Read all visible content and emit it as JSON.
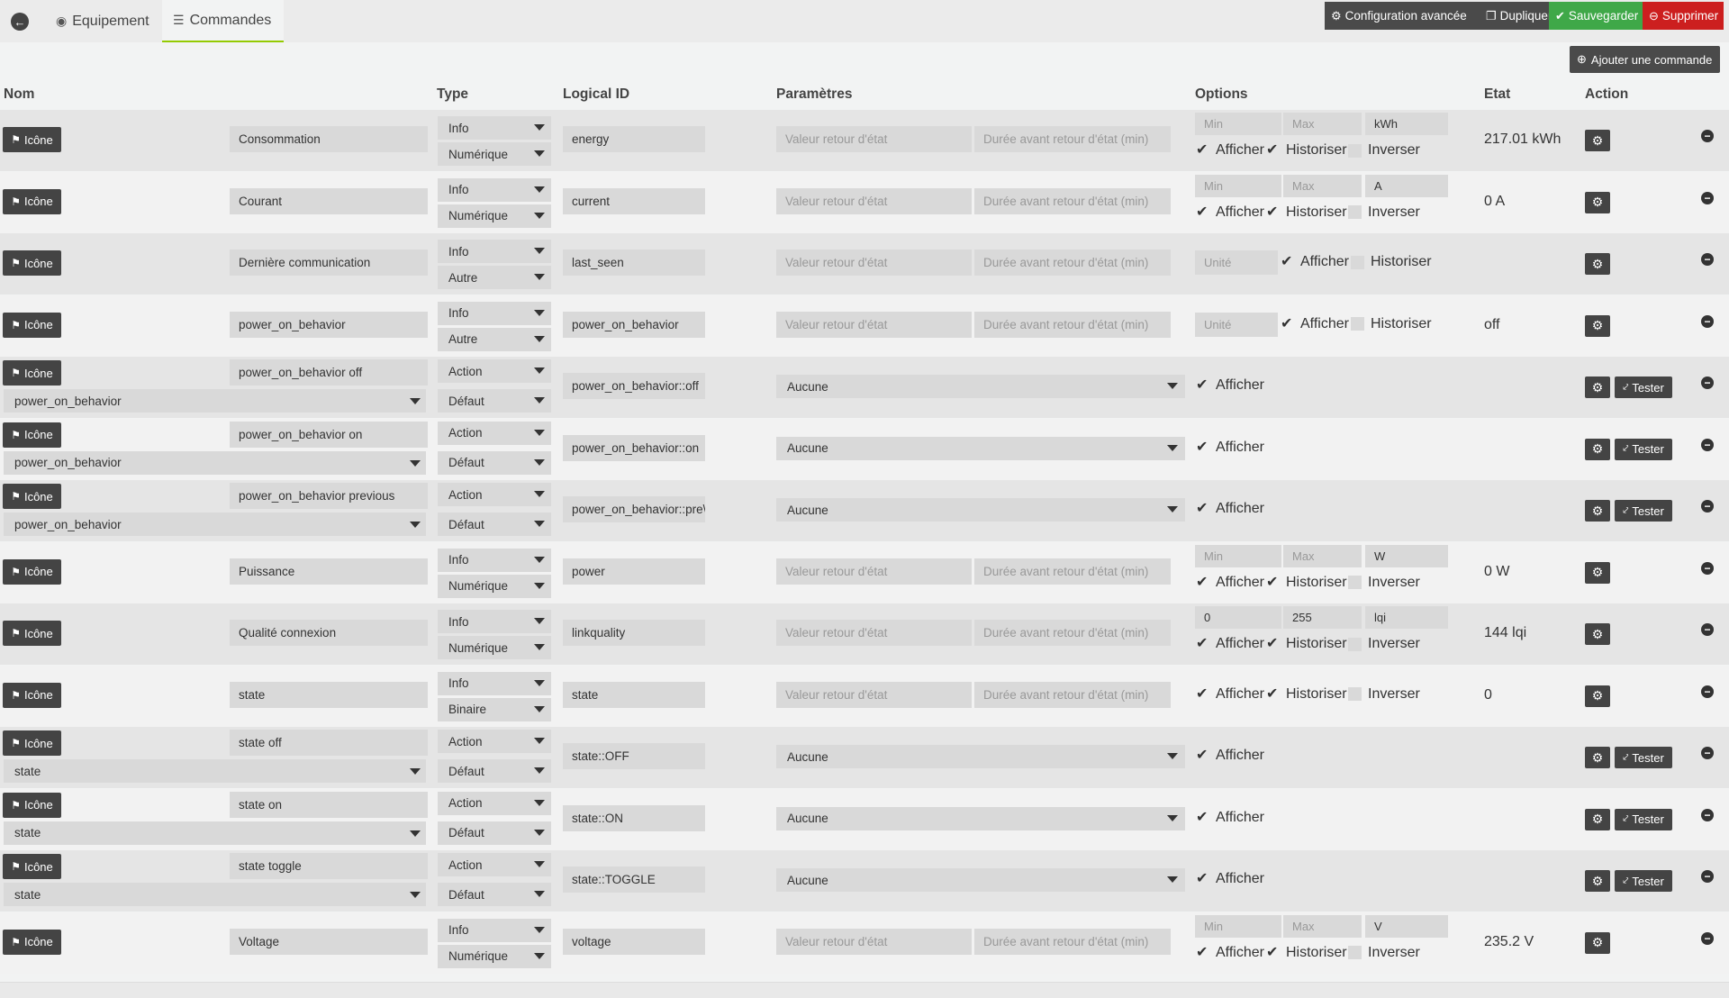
{
  "tabs": {
    "back_icon": "arrow-left-icon",
    "equipement": "Equipement",
    "commandes": "Commandes"
  },
  "toolbar": {
    "config": "Configuration avancée",
    "dupliquer": "Dupliquer",
    "sauvegarder": "Sauvegarder",
    "supprimer": "Supprimer"
  },
  "add_command": "Ajouter une commande",
  "headers": {
    "nom": "Nom",
    "type": "Type",
    "logical_id": "Logical ID",
    "parametres": "Paramètres",
    "options": "Options",
    "etat": "Etat",
    "action": "Action"
  },
  "labels": {
    "icone": "Icône",
    "afficher": "Afficher",
    "historiser": "Historiser",
    "inverser": "Inverser",
    "tester": "Tester",
    "valeur_retour": "Valeur retour d'état",
    "duree_retour": "Durée avant retour d'état (min)",
    "min": "Min",
    "max": "Max",
    "unite": "Unité",
    "aucune": "Aucune"
  },
  "colors": {
    "dark": "#4a4a4a",
    "green": "#3fa848",
    "red": "#cc1f1f",
    "tab_underline": "#94ca02"
  },
  "rows": [
    {
      "kind": "info",
      "name": "Consommation",
      "type": "Info",
      "subtype": "Numérique",
      "logical_id": "energy",
      "options": "minmax",
      "min": "",
      "max": "",
      "unit": "kWh",
      "afficher": true,
      "historiser": true,
      "inverser": false,
      "etat": "217.01 kWh"
    },
    {
      "kind": "info",
      "name": "Courant",
      "type": "Info",
      "subtype": "Numérique",
      "logical_id": "current",
      "options": "minmax",
      "min": "",
      "max": "",
      "unit": "A",
      "afficher": true,
      "historiser": true,
      "inverser": false,
      "etat": "0 A"
    },
    {
      "kind": "info",
      "name": "Dernière communication",
      "type": "Info",
      "subtype": "Autre",
      "logical_id": "last_seen",
      "options": "unit",
      "unit": "",
      "afficher": true,
      "historiser": false,
      "etat": ""
    },
    {
      "kind": "info",
      "name": "power_on_behavior",
      "type": "Info",
      "subtype": "Autre",
      "logical_id": "power_on_behavior",
      "options": "unit",
      "unit": "",
      "afficher": true,
      "historiser": false,
      "etat": "off"
    },
    {
      "kind": "action",
      "name": "power_on_behavior off",
      "value": "power_on_behavior",
      "type": "Action",
      "subtype": "Défaut",
      "logical_id": "power_on_behavior::off",
      "param": "Aucune",
      "afficher": true
    },
    {
      "kind": "action",
      "name": "power_on_behavior on",
      "value": "power_on_behavior",
      "type": "Action",
      "subtype": "Défaut",
      "logical_id": "power_on_behavior::on",
      "param": "Aucune",
      "afficher": true
    },
    {
      "kind": "action",
      "name": "power_on_behavior previous",
      "value": "power_on_behavior",
      "type": "Action",
      "subtype": "Défaut",
      "logical_id": "power_on_behavior::pre\\",
      "param": "Aucune",
      "afficher": true
    },
    {
      "kind": "info",
      "name": "Puissance",
      "type": "Info",
      "subtype": "Numérique",
      "logical_id": "power",
      "options": "minmax",
      "min": "",
      "max": "",
      "unit": "W",
      "afficher": true,
      "historiser": true,
      "inverser": false,
      "etat": "0 W"
    },
    {
      "kind": "info",
      "name": "Qualité connexion",
      "type": "Info",
      "subtype": "Numérique",
      "logical_id": "linkquality",
      "options": "minmax",
      "min": "0",
      "max": "255",
      "unit": "lqi",
      "afficher": true,
      "historiser": true,
      "inverser": false,
      "etat": "144 lqi"
    },
    {
      "kind": "info",
      "name": "state",
      "type": "Info",
      "subtype": "Binaire",
      "logical_id": "state",
      "options": "binary",
      "afficher": true,
      "historiser": true,
      "inverser": false,
      "etat": "0"
    },
    {
      "kind": "action",
      "name": "state off",
      "value": "state",
      "type": "Action",
      "subtype": "Défaut",
      "logical_id": "state::OFF",
      "param": "Aucune",
      "afficher": true
    },
    {
      "kind": "action",
      "name": "state on",
      "value": "state",
      "type": "Action",
      "subtype": "Défaut",
      "logical_id": "state::ON",
      "param": "Aucune",
      "afficher": true
    },
    {
      "kind": "action",
      "name": "state toggle",
      "value": "state",
      "type": "Action",
      "subtype": "Défaut",
      "logical_id": "state::TOGGLE",
      "param": "Aucune",
      "afficher": true
    },
    {
      "kind": "info",
      "name": "Voltage",
      "type": "Info",
      "subtype": "Numérique",
      "logical_id": "voltage",
      "options": "minmax",
      "min": "",
      "max": "",
      "unit": "V",
      "afficher": true,
      "historiser": true,
      "inverser": false,
      "etat": "235.2 V"
    }
  ]
}
